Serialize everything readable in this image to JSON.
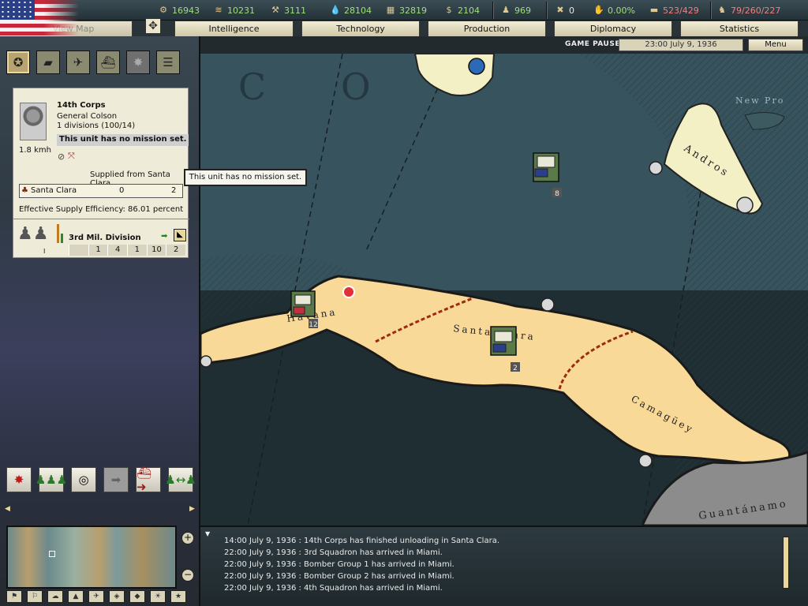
{
  "resources": [
    {
      "name": "energy",
      "icon": "gear-icon",
      "value": "16943",
      "color": "green"
    },
    {
      "name": "metal",
      "icon": "metal-icon",
      "value": "10231",
      "color": "green"
    },
    {
      "name": "rare-materials",
      "icon": "rare-icon",
      "value": "3111",
      "color": "green"
    },
    {
      "name": "oil",
      "icon": "oil-drop-icon",
      "value": "28104",
      "color": "green"
    },
    {
      "name": "supplies",
      "icon": "crate-icon",
      "value": "32819",
      "color": "green"
    },
    {
      "name": "money",
      "icon": "dollar-icon",
      "value": "2104",
      "color": "green"
    },
    {
      "name": "manpower",
      "icon": "soldiers-icon",
      "value": "969",
      "color": "green"
    },
    {
      "name": "dissent",
      "icon": "crossed-icon",
      "value": "0",
      "color": "white"
    },
    {
      "name": "dissent-percent",
      "icon": "hand-icon",
      "value": "0.00%",
      "color": "green"
    },
    {
      "name": "transport",
      "icon": "truck-icon",
      "value": "523/429",
      "color": "pink"
    },
    {
      "name": "escorts",
      "icon": "escort-icon",
      "value": "79/260/227",
      "color": "pink"
    }
  ],
  "tabs": [
    "View Map",
    "Intelligence",
    "Technology",
    "Production",
    "Diplomacy",
    "Statistics"
  ],
  "status": {
    "paused": "GAME PAUSED",
    "date": "23:00 July 9, 1936",
    "menu": "Menu"
  },
  "unit": {
    "name": "14th Corps",
    "general": "General Colson",
    "divisions": "1 divisions (100/14)",
    "mission": "This unit has no mission set.",
    "speed": "1.8 kmh",
    "supplied_from": "Supplied from Santa Clara",
    "supply_province": "Santa Clara",
    "supply_a": "0",
    "supply_b": "2",
    "efficiency": "Effective Supply Efficiency: 86.01 percent",
    "division_name": "3rd Mil. Division",
    "division_rank": "I",
    "division_stats": [
      "",
      "1",
      "4",
      "1",
      "10",
      "2"
    ]
  },
  "tooltip": "This unit has no mission set.",
  "map": {
    "labels": {
      "havana": "Havana",
      "santa_clara": "Santa Clara",
      "camaguey": "Camagüey",
      "andros": "Andros",
      "new_providence": "New Pro",
      "guantanamo": "Guantánamo",
      "sea_letters": "C O"
    },
    "stack_counts": {
      "havana": "12",
      "santa_clara": "2",
      "sea": "8"
    }
  },
  "log": [
    "14:00 July 9, 1936 : 14th Corps has finished unloading in Santa Clara.",
    "22:00 July 9, 1936 : 3rd Squadron has arrived in Miami.",
    "22:00 July 9, 1936 : Bomber Group 1 has arrived in Miami.",
    "22:00 July 9, 1936 : Bomber Group 2 has arrived in Miami.",
    "22:00 July 9, 1936 : 4th Squadron has arrived in Miami."
  ]
}
